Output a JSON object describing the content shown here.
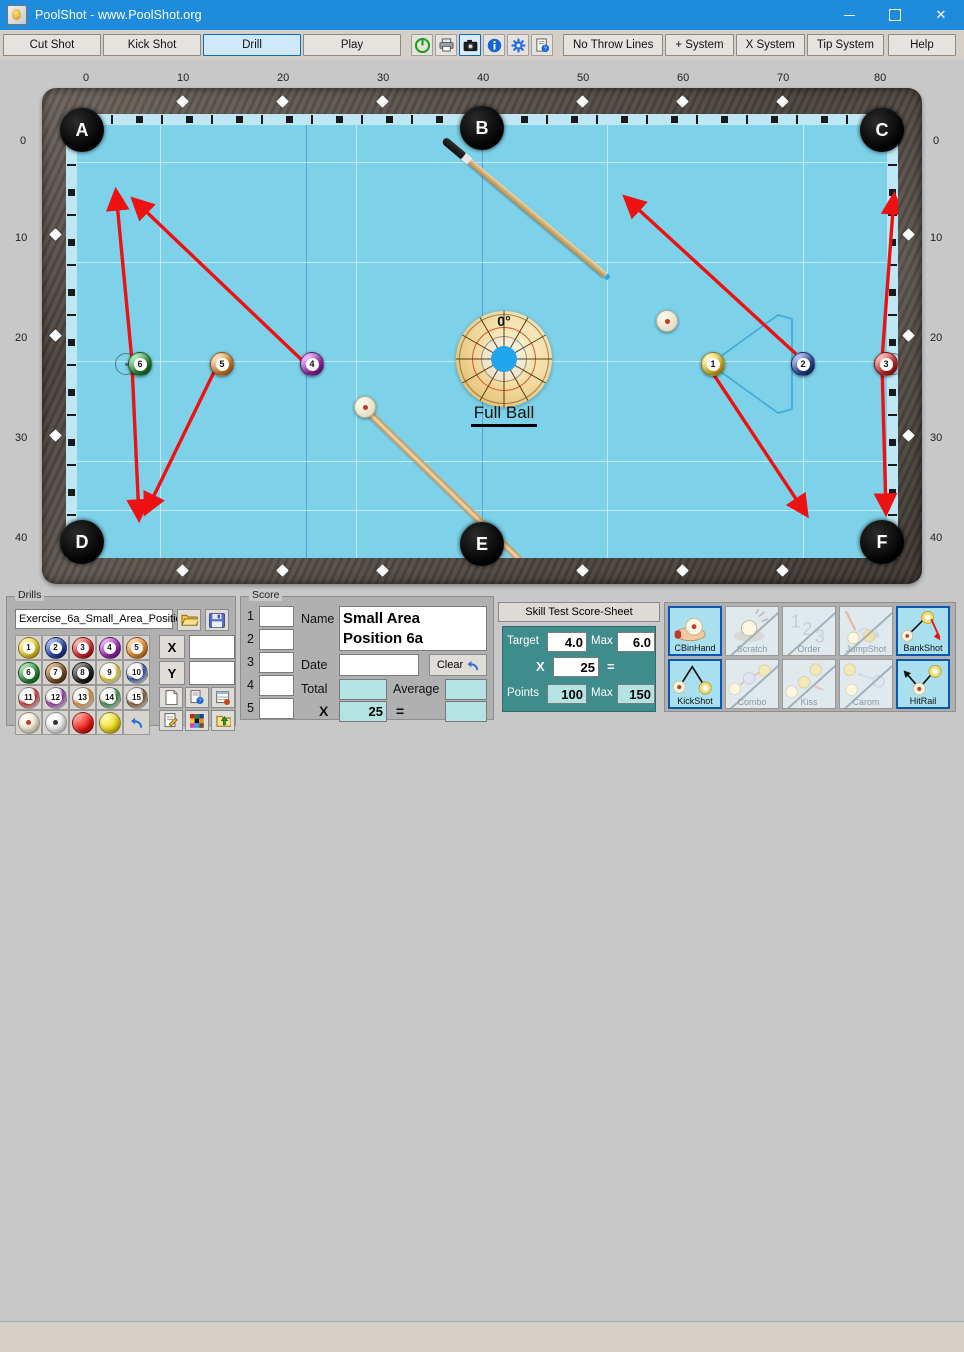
{
  "window": {
    "title": "PoolShot - www.PoolShot.org",
    "icon": "poolshot-logo-icon",
    "minimize": "minimize-icon",
    "maximize": "maximize-icon",
    "close": "close-icon"
  },
  "toolbar": {
    "tabs": [
      {
        "label": "Cut Shot",
        "active": false
      },
      {
        "label": "Kick Shot",
        "active": false
      },
      {
        "label": "Drill",
        "active": true
      },
      {
        "label": "Play",
        "active": false
      }
    ],
    "icons": [
      {
        "name": "power-icon",
        "selected": false
      },
      {
        "name": "printer-icon",
        "selected": false
      },
      {
        "name": "camera-icon",
        "selected": true
      },
      {
        "name": "info-icon",
        "selected": false
      },
      {
        "name": "gear-icon",
        "selected": false
      },
      {
        "name": "document-help-icon",
        "selected": false
      }
    ],
    "systems": [
      {
        "label": "No Throw Lines"
      },
      {
        "label": "+ System"
      },
      {
        "label": "X System"
      },
      {
        "label": "Tip System"
      }
    ],
    "help_label": "Help"
  },
  "table": {
    "ruler_top": [
      "0",
      "10",
      "20",
      "30",
      "40",
      "50",
      "60",
      "70",
      "80"
    ],
    "ruler_left": [
      "0",
      "10",
      "20",
      "30",
      "40"
    ],
    "ruler_right": [
      "0",
      "10",
      "20",
      "30",
      "40"
    ],
    "pockets": [
      {
        "label": "A"
      },
      {
        "label": "B"
      },
      {
        "label": "C"
      },
      {
        "label": "D"
      },
      {
        "label": "E"
      },
      {
        "label": "F"
      }
    ],
    "balls": [
      {
        "number": "6",
        "color": "#1f8a2f"
      },
      {
        "number": "5",
        "color": "#e8892a"
      },
      {
        "number": "4",
        "color": "#9b21b5"
      },
      {
        "number": "1",
        "color": "#f0cf22"
      },
      {
        "number": "2",
        "color": "#1d3fa0"
      },
      {
        "number": "3",
        "color": "#d62020"
      }
    ],
    "aim": {
      "degrees": "0°",
      "label": "Full Ball",
      "center_color": "#1fa6ec"
    },
    "cue_balls": 2,
    "cue_sticks": 2,
    "arrow_color": "#ee1111",
    "cloth_color": "#7dd2e9"
  },
  "drills": {
    "group_title": "Drills",
    "filename": "Exercise_6a_Small_Area_Positio",
    "open_icon": "open-folder-icon",
    "save_icon": "save-disk-icon",
    "x_label": "X",
    "y_label": "Y",
    "x_value": "",
    "y_value": "",
    "ball_grid": [
      {
        "number": "1",
        "color": "#f0cf22",
        "stripe": false
      },
      {
        "number": "2",
        "color": "#1d3fa0",
        "stripe": false
      },
      {
        "number": "3",
        "color": "#d62020",
        "stripe": false
      },
      {
        "number": "4",
        "color": "#9b21b5",
        "stripe": false
      },
      {
        "number": "5",
        "color": "#e8892a",
        "stripe": false
      },
      {
        "number": "6",
        "color": "#1f8a2f",
        "stripe": false
      },
      {
        "number": "7",
        "color": "#7a4a1e",
        "stripe": false
      },
      {
        "number": "8",
        "color": "#1a1a1a",
        "stripe": false
      },
      {
        "number": "9",
        "color": "#f0cf22",
        "stripe": true
      },
      {
        "number": "10",
        "color": "#1d3fa0",
        "stripe": true
      },
      {
        "number": "11",
        "color": "#d62020",
        "stripe": true
      },
      {
        "number": "12",
        "color": "#9b21b5",
        "stripe": true
      },
      {
        "number": "13",
        "color": "#e8892a",
        "stripe": true
      },
      {
        "number": "14",
        "color": "#1f8a2f",
        "stripe": true
      },
      {
        "number": "15",
        "color": "#7a4a1e",
        "stripe": true
      }
    ],
    "extra_balls": [
      {
        "name": "cue-ball-red-dot",
        "color": "#f3ead0",
        "dot": "#c0392b"
      },
      {
        "name": "cue-ball-black-dot",
        "color": "#f2f2f2",
        "dot": "#333333"
      },
      {
        "name": "red-ball",
        "color": "#ee1111",
        "dot": ""
      },
      {
        "name": "yellow-ball",
        "color": "#eedd11",
        "dot": ""
      },
      {
        "name": "undo-icon",
        "color": "",
        "dot": ""
      }
    ],
    "tool_icons": [
      "new-document-icon",
      "document-help-icon",
      "table-list-icon",
      "edit-note-icon",
      "color-palette-icon",
      "export-folder-icon"
    ]
  },
  "score": {
    "group_title": "Score",
    "rows": [
      "1",
      "2",
      "3",
      "4",
      "5"
    ],
    "row_values": [
      "",
      "",
      "",
      "",
      ""
    ],
    "name_label": "Name",
    "name_value": "Small Area Position 6a",
    "date_label": "Date",
    "date_value": "",
    "clear_label": "Clear",
    "clear_icon": "undo-arrow-icon",
    "total_label": "Total",
    "total_value": "",
    "average_label": "Average",
    "average_value": "",
    "multiply_label": "X",
    "multiplier_value": "25",
    "equals_label": "=",
    "result_value": ""
  },
  "skill": {
    "header": "Skill Test Score-Sheet",
    "target_label": "Target",
    "target_value": "4.0",
    "target_max_label": "Max",
    "target_max_value": "6.0",
    "multiply_label": "X",
    "multiplier_value": "25",
    "equals_label": "=",
    "points_label": "Points",
    "points_value": "100",
    "points_max_label": "Max",
    "points_max_value": "150"
  },
  "rules": {
    "row1": [
      {
        "label": "CBinHand",
        "enabled": true
      },
      {
        "label": "Scratch",
        "enabled": false
      },
      {
        "label": "Order",
        "enabled": false
      },
      {
        "label": "JumpShot",
        "enabled": false
      },
      {
        "label": "BankShot",
        "enabled": true
      }
    ],
    "row2": [
      {
        "label": "KickShot",
        "enabled": true
      },
      {
        "label": "Combo",
        "enabled": false
      },
      {
        "label": "Kiss",
        "enabled": false
      },
      {
        "label": "Carom",
        "enabled": false
      },
      {
        "label": "HitRail",
        "enabled": true
      }
    ]
  }
}
